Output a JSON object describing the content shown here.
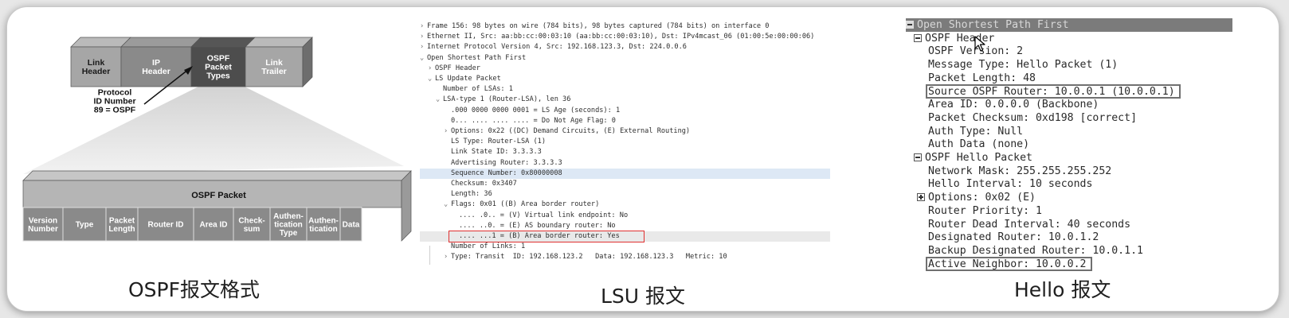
{
  "panel1": {
    "caption": "OSPF报文格式",
    "ip_packet_segments": [
      {
        "label": "Link\nHeader",
        "color": "#a6a6a6",
        "text_color": "#1a1a1a"
      },
      {
        "label": "IP\nHeader",
        "color": "#8a8a8a",
        "text_color": "#ffffff"
      },
      {
        "label": "OSPF\nPacket\nTypes",
        "color": "#4d4d4d",
        "text_color": "#ffffff"
      },
      {
        "label": "Link\nTrailer",
        "color": "#a6a6a6",
        "text_color": "#ffffff"
      }
    ],
    "annotation": "Protocol\nID Number\n89 = OSPF",
    "ospf_packet_title": "OSPF Packet",
    "ospf_fields": [
      {
        "label": "Version\nNumber",
        "color": "#8a8a8a"
      },
      {
        "label": "Type",
        "color": "#8a8a8a"
      },
      {
        "label": "Packet\nLength",
        "color": "#8a8a8a"
      },
      {
        "label": "Router ID",
        "color": "#8a8a8a"
      },
      {
        "label": "Area ID",
        "color": "#8a8a8a"
      },
      {
        "label": "Check-\nsum",
        "color": "#8a8a8a"
      },
      {
        "label": "Authen-\ntication\nType",
        "color": "#8a8a8a"
      },
      {
        "label": "Authen-\ntication",
        "color": "#8a8a8a"
      },
      {
        "label": "Data",
        "color": "#8a8a8a"
      }
    ]
  },
  "panel2": {
    "caption": "LSU 报文",
    "lines": [
      {
        "indent": 0,
        "twisty": "›",
        "text": "Frame 156: 98 bytes on wire (784 bits), 98 bytes captured (784 bits) on interface 0"
      },
      {
        "indent": 0,
        "twisty": "›",
        "text": "Ethernet II, Src: aa:bb:cc:00:03:10 (aa:bb:cc:00:03:10), Dst: IPv4mcast_06 (01:00:5e:00:00:06)"
      },
      {
        "indent": 0,
        "twisty": "›",
        "text": "Internet Protocol Version 4, Src: 192.168.123.3, Dst: 224.0.0.6"
      },
      {
        "indent": 0,
        "twisty": "⌄",
        "text": "Open Shortest Path First"
      },
      {
        "indent": 1,
        "twisty": "›",
        "text": "OSPF Header"
      },
      {
        "indent": 1,
        "twisty": "⌄",
        "text": "LS Update Packet"
      },
      {
        "indent": 2,
        "twisty": "",
        "text": "Number of LSAs: 1"
      },
      {
        "indent": 2,
        "twisty": "⌄",
        "text": "LSA-type 1 (Router-LSA), len 36"
      },
      {
        "indent": 3,
        "twisty": "",
        "text": ".000 0000 0000 0001 = LS Age (seconds): 1"
      },
      {
        "indent": 3,
        "twisty": "",
        "text": "0... .... .... .... = Do Not Age Flag: 0"
      },
      {
        "indent": 3,
        "twisty": "›",
        "text": "Options: 0x22 ((DC) Demand Circuits, (E) External Routing)"
      },
      {
        "indent": 3,
        "twisty": "",
        "text": "LS Type: Router-LSA (1)"
      },
      {
        "indent": 3,
        "twisty": "",
        "text": "Link State ID: 3.3.3.3"
      },
      {
        "indent": 3,
        "twisty": "",
        "text": "Advertising Router: 3.3.3.3"
      },
      {
        "indent": 3,
        "twisty": "",
        "text": "Sequence Number: 0x80000008",
        "style": "sel"
      },
      {
        "indent": 3,
        "twisty": "",
        "text": "Checksum: 0x3407"
      },
      {
        "indent": 3,
        "twisty": "",
        "text": "Length: 36"
      },
      {
        "indent": 3,
        "twisty": "⌄",
        "text": "Flags: 0x01 ((B) Area border router)"
      },
      {
        "indent": 4,
        "twisty": "",
        "text": ".... .0.. = (V) Virtual link endpoint: No"
      },
      {
        "indent": 4,
        "twisty": "",
        "text": ".... ..0. = (E) AS boundary router: No"
      },
      {
        "indent": 4,
        "twisty": "",
        "text": ".... ...1 = (B) Area border router: Yes",
        "style": "hl"
      },
      {
        "indent": 3,
        "twisty": "",
        "text": "Number of Links: 1"
      },
      {
        "indent": 3,
        "twisty": "›",
        "text": "Type: Transit  ID: 192.168.123.2   Data: 192.168.123.3   Metric: 10"
      }
    ],
    "box_color": "#e03030"
  },
  "panel3": {
    "caption": "Hello 报文",
    "lines": [
      {
        "indent": 0,
        "toggle": "minus",
        "text": "Open Shortest Path First",
        "style": "top-sel"
      },
      {
        "indent": 1,
        "toggle": "minus",
        "text": "OSPF Header"
      },
      {
        "indent": 2,
        "toggle": "",
        "text": "OSPF Version: 2"
      },
      {
        "indent": 2,
        "toggle": "",
        "text": "Message Type: Hello Packet (1)"
      },
      {
        "indent": 2,
        "toggle": "",
        "text": "Packet Length: 48"
      },
      {
        "indent": 2,
        "toggle": "",
        "text": "Source OSPF Router: 10.0.0.1 (10.0.0.1)",
        "boxed": true
      },
      {
        "indent": 2,
        "toggle": "",
        "text": "Area ID: 0.0.0.0 (Backbone)"
      },
      {
        "indent": 2,
        "toggle": "",
        "text": "Packet Checksum: 0xd198 [correct]"
      },
      {
        "indent": 2,
        "toggle": "",
        "text": "Auth Type: Null"
      },
      {
        "indent": 2,
        "toggle": "",
        "text": "Auth Data (none)"
      },
      {
        "indent": 1,
        "toggle": "minus",
        "text": "OSPF Hello Packet"
      },
      {
        "indent": 2,
        "toggle": "",
        "text": "Network Mask: 255.255.255.252"
      },
      {
        "indent": 2,
        "toggle": "",
        "text": "Hello Interval: 10 seconds"
      },
      {
        "indent": 2,
        "toggle": "plus",
        "text": "Options: 0x02 (E)"
      },
      {
        "indent": 2,
        "toggle": "",
        "text": "Router Priority: 1"
      },
      {
        "indent": 2,
        "toggle": "",
        "text": "Router Dead Interval: 40 seconds"
      },
      {
        "indent": 2,
        "toggle": "",
        "text": "Designated Router: 10.0.1.2"
      },
      {
        "indent": 2,
        "toggle": "",
        "text": "Backup Designated Router: 10.0.1.1"
      },
      {
        "indent": 2,
        "toggle": "",
        "text": "Active Neighbor: 10.0.0.2",
        "boxed": true
      }
    ]
  }
}
